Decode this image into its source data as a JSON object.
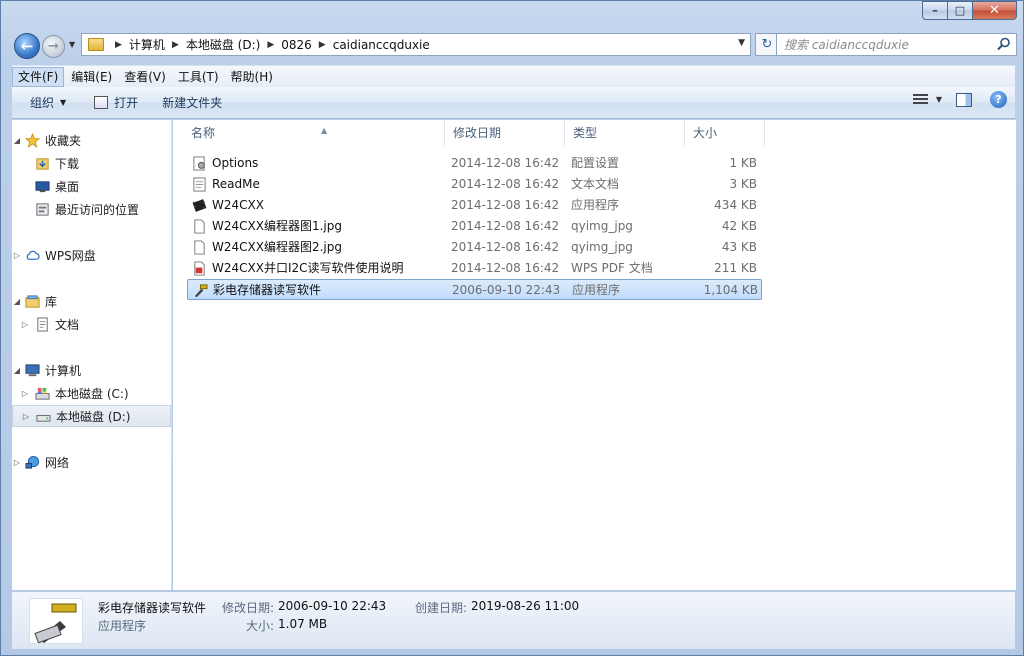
{
  "window": {
    "caption": {
      "minimize": "–",
      "maximize": "□",
      "close": "✕"
    }
  },
  "address": {
    "back_glyph": "←",
    "forward_glyph": "→",
    "crumbs": [
      "计算机",
      "本地磁盘 (D:)",
      "0826",
      "caidianccqduxie"
    ],
    "refresh_glyph": "↻",
    "search_placeholder": "搜索 caidianccqduxie"
  },
  "menubar": {
    "items": [
      "文件(F)",
      "编辑(E)",
      "查看(V)",
      "工具(T)",
      "帮助(H)"
    ]
  },
  "toolbar": {
    "organize": "组织",
    "open": "打开",
    "new_folder": "新建文件夹",
    "help": "?"
  },
  "navpane": {
    "favorites": "收藏夹",
    "downloads": "下载",
    "desktop": "桌面",
    "recent": "最近访问的位置",
    "wps": "WPS网盘",
    "libraries": "库",
    "documents": "文档",
    "computer": "计算机",
    "drive_c": "本地磁盘 (C:)",
    "drive_d": "本地磁盘 (D:)",
    "network": "网络"
  },
  "columns": {
    "name": "名称",
    "date": "修改日期",
    "type": "类型",
    "size": "大小"
  },
  "files": [
    {
      "name": "Options",
      "date": "2014-12-08 16:42",
      "type": "配置设置",
      "size": "1 KB",
      "icon": "settings-file-icon"
    },
    {
      "name": "ReadMe",
      "date": "2014-12-08 16:42",
      "type": "文本文档",
      "size": "3 KB",
      "icon": "text-file-icon"
    },
    {
      "name": "W24CXX",
      "date": "2014-12-08 16:42",
      "type": "应用程序",
      "size": "434 KB",
      "icon": "chip-app-icon"
    },
    {
      "name": "W24CXX编程器图1.jpg",
      "date": "2014-12-08 16:42",
      "type": "qyimg_jpg",
      "size": "42 KB",
      "icon": "blank-file-icon"
    },
    {
      "name": "W24CXX编程器图2.jpg",
      "date": "2014-12-08 16:42",
      "type": "qyimg_jpg",
      "size": "43 KB",
      "icon": "blank-file-icon"
    },
    {
      "name": "W24CXX并口I2C读写软件使用说明",
      "date": "2014-12-08 16:42",
      "type": "WPS PDF 文档",
      "size": "211 KB",
      "icon": "pdf-file-icon"
    },
    {
      "name": "彩电存储器读写软件",
      "date": "2006-09-10 22:43",
      "type": "应用程序",
      "size": "1,104 KB",
      "icon": "programmer-app-icon",
      "selected": true
    }
  ],
  "details": {
    "name": "彩电存储器读写软件",
    "type": "应用程序",
    "modified_label": "修改日期:",
    "modified_value": "2006-09-10 22:43",
    "created_label": "创建日期:",
    "created_value": "2019-08-26 11:00",
    "size_label": "大小:",
    "size_value": "1.07 MB"
  }
}
